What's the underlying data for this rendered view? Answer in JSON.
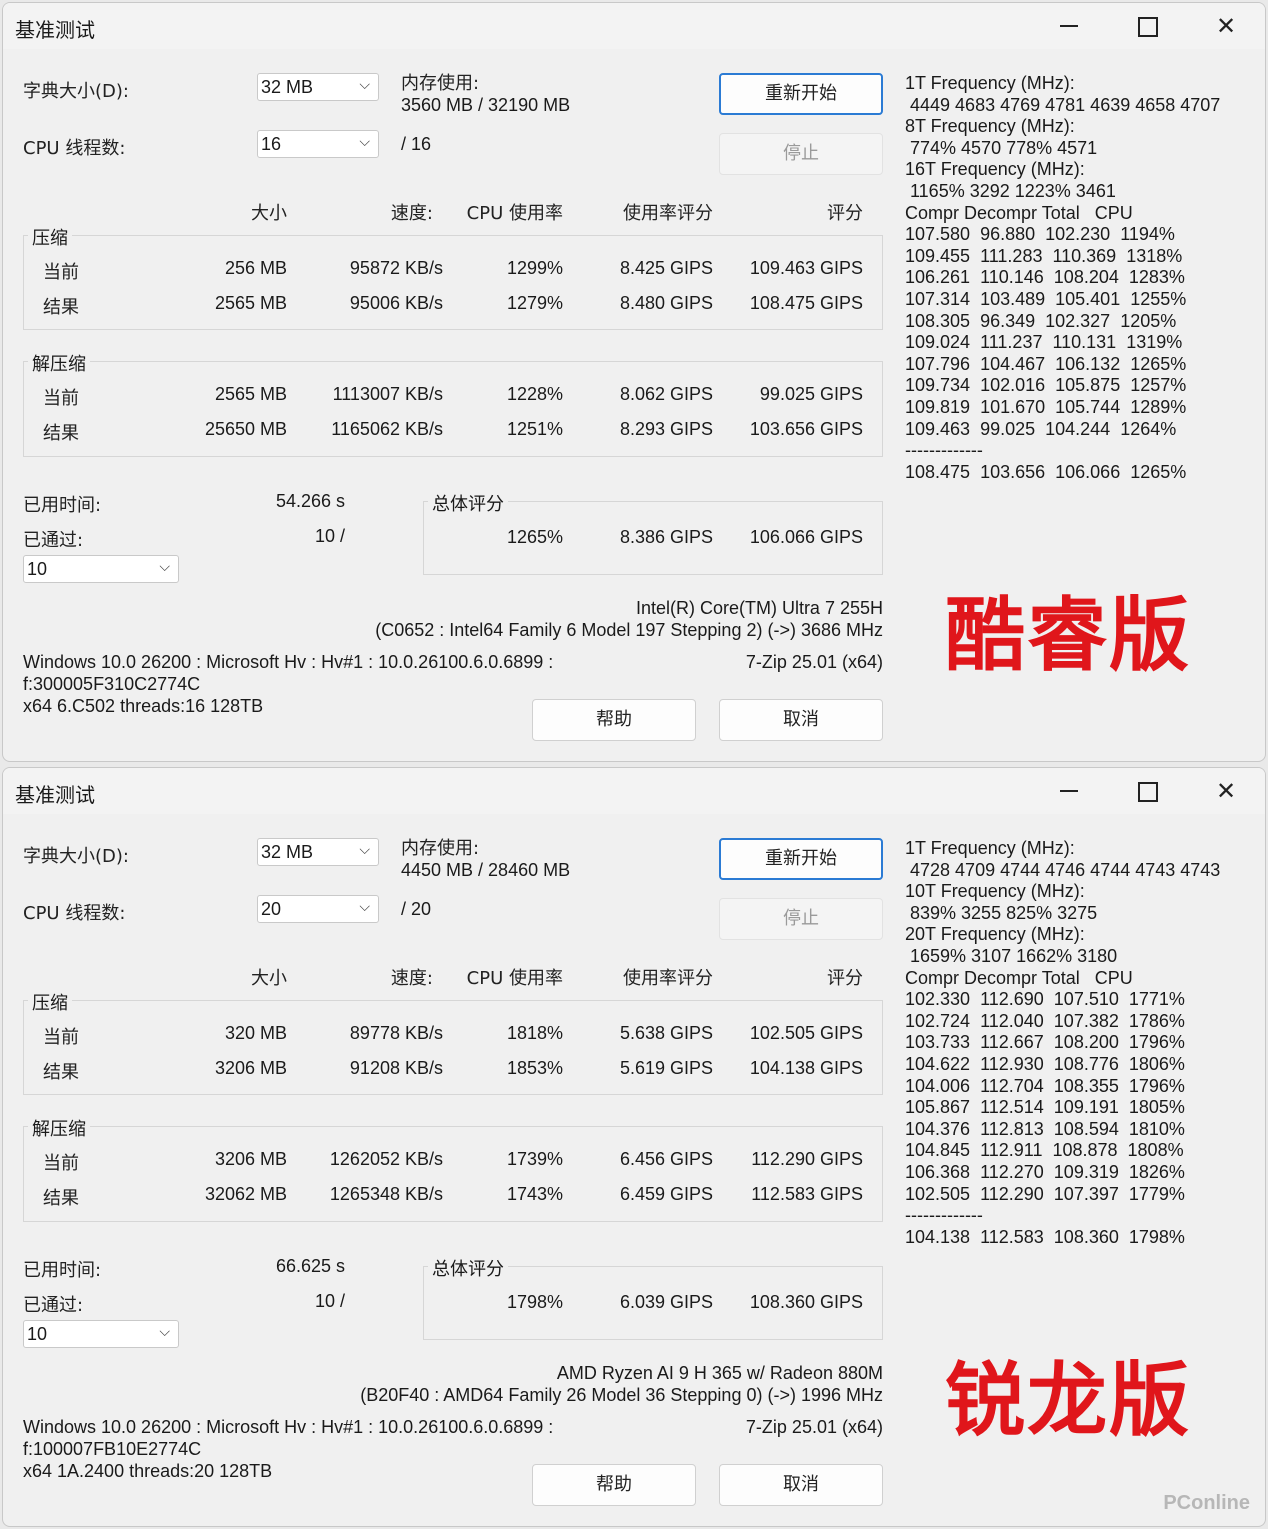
{
  "windows": [
    {
      "title": "基准测试",
      "dict_label": "字典大小(D):",
      "dict_value": "32 MB",
      "threads_label": "CPU 线程数:",
      "threads_value": "16",
      "threads_max": "/ 16",
      "mem_label": "内存使用:",
      "mem_value": "3560 MB / 32190 MB",
      "restart_label": "重新开始",
      "stop_label": "停止",
      "headers": [
        "大小",
        "速度:",
        "CPU 使用率",
        "使用率评分",
        "评分"
      ],
      "compress_title": "压缩",
      "decompress_title": "解压缩",
      "compress_rows": [
        {
          "label": "当前",
          "size": "256 MB",
          "speed": "95872 KB/s",
          "usage": "1299%",
          "rating": "8.425 GIPS",
          "score": "109.463 GIPS"
        },
        {
          "label": "结果",
          "size": "2565 MB",
          "speed": "95006 KB/s",
          "usage": "1279%",
          "rating": "8.480 GIPS",
          "score": "108.475 GIPS"
        }
      ],
      "decompress_rows": [
        {
          "label": "当前",
          "size": "2565 MB",
          "speed": "1113007 KB/s",
          "usage": "1228%",
          "rating": "8.062 GIPS",
          "score": "99.025 GIPS"
        },
        {
          "label": "结果",
          "size": "25650 MB",
          "speed": "1165062 KB/s",
          "usage": "1251%",
          "rating": "8.293 GIPS",
          "score": "103.656 GIPS"
        }
      ],
      "elapsed_label": "已用时间:",
      "elapsed_value": "54.266 s",
      "passed_label": "已通过:",
      "passed_value": "10 /",
      "passes_select": "10",
      "total_title": "总体评分",
      "total_usage": "1265%",
      "total_rating": "8.386 GIPS",
      "total_score": "106.066 GIPS",
      "cpu_name": "Intel(R) Core(TM) Ultra 7 255H",
      "cpu_detail": "(C0652 : Intel64 Family 6 Model 197 Stepping 2) (->) 3686 MHz",
      "os_line1": "Windows 10.0 26200 : Microsoft Hv : Hv#1 : 10.0.26100.6.0.6899 :",
      "os_line2": "f:300005F310C2774C",
      "os_line3": "x64 6.C502 threads:16 128TB",
      "version": "7-Zip 25.01 (x64)",
      "help_label": "帮助",
      "cancel_label": "取消",
      "side_lines": [
        "1T Frequency (MHz):",
        " 4449 4683 4769 4781 4639 4658 4707",
        "8T Frequency (MHz):",
        " 774% 4570 778% 4571",
        "16T Frequency (MHz):",
        " 1165% 3292 1223% 3461",
        "Compr Decompr Total   CPU",
        "107.580  96.880  102.230  1194%",
        "109.455  111.283  110.369  1318%",
        "106.261  110.146  108.204  1283%",
        "107.314  103.489  105.401  1255%",
        "108.305  96.349  102.327  1205%",
        "109.024  111.237  110.131  1319%",
        "107.796  104.467  106.132  1265%",
        "109.734  102.016  105.875  1257%",
        "109.819  101.670  105.744  1289%",
        "109.463  99.025  104.244  1264%",
        "-------------",
        "108.475  103.656  106.066  1265%"
      ],
      "brand": "酷睿版"
    },
    {
      "title": "基准测试",
      "dict_label": "字典大小(D):",
      "dict_value": "32 MB",
      "threads_label": "CPU 线程数:",
      "threads_value": "20",
      "threads_max": "/ 20",
      "mem_label": "内存使用:",
      "mem_value": "4450 MB / 28460 MB",
      "restart_label": "重新开始",
      "stop_label": "停止",
      "headers": [
        "大小",
        "速度:",
        "CPU 使用率",
        "使用率评分",
        "评分"
      ],
      "compress_title": "压缩",
      "decompress_title": "解压缩",
      "compress_rows": [
        {
          "label": "当前",
          "size": "320 MB",
          "speed": "89778 KB/s",
          "usage": "1818%",
          "rating": "5.638 GIPS",
          "score": "102.505 GIPS"
        },
        {
          "label": "结果",
          "size": "3206 MB",
          "speed": "91208 KB/s",
          "usage": "1853%",
          "rating": "5.619 GIPS",
          "score": "104.138 GIPS"
        }
      ],
      "decompress_rows": [
        {
          "label": "当前",
          "size": "3206 MB",
          "speed": "1262052 KB/s",
          "usage": "1739%",
          "rating": "6.456 GIPS",
          "score": "112.290 GIPS"
        },
        {
          "label": "结果",
          "size": "32062 MB",
          "speed": "1265348 KB/s",
          "usage": "1743%",
          "rating": "6.459 GIPS",
          "score": "112.583 GIPS"
        }
      ],
      "elapsed_label": "已用时间:",
      "elapsed_value": "66.625 s",
      "passed_label": "已通过:",
      "passed_value": "10 /",
      "passes_select": "10",
      "total_title": "总体评分",
      "total_usage": "1798%",
      "total_rating": "6.039 GIPS",
      "total_score": "108.360 GIPS",
      "cpu_name": "AMD Ryzen AI 9 H 365 w/ Radeon 880M",
      "cpu_detail": "(B20F40 : AMD64 Family 26 Model 36 Stepping 0) (->) 1996 MHz",
      "os_line1": "Windows 10.0 26200 : Microsoft Hv : Hv#1 : 10.0.26100.6.0.6899 :",
      "os_line2": "f:100007FB10E2774C",
      "os_line3": "x64 1A.2400 threads:20 128TB",
      "version": "7-Zip 25.01 (x64)",
      "help_label": "帮助",
      "cancel_label": "取消",
      "side_lines": [
        "1T Frequency (MHz):",
        " 4728 4709 4744 4746 4744 4743 4743",
        "10T Frequency (MHz):",
        " 839% 3255 825% 3275",
        "20T Frequency (MHz):",
        " 1659% 3107 1662% 3180",
        "Compr Decompr Total   CPU",
        "102.330  112.690  107.510  1771%",
        "102.724  112.040  107.382  1786%",
        "103.733  112.667  108.200  1796%",
        "104.622  112.930  108.776  1806%",
        "104.006  112.704  108.355  1796%",
        "105.867  112.514  109.191  1805%",
        "104.376  112.813  108.594  1810%",
        "104.845  112.911  108.878  1808%",
        "106.368  112.270  109.319  1826%",
        "102.505  112.290  107.397  1779%",
        "-------------",
        "104.138  112.583  108.360  1798%"
      ],
      "brand": "锐龙版"
    }
  ],
  "watermark": "PConline"
}
